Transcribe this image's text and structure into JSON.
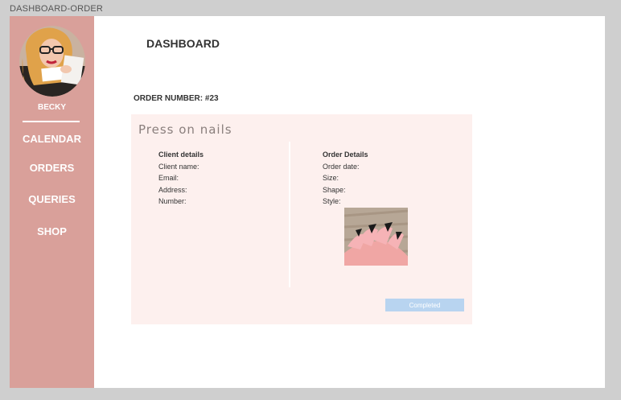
{
  "frame_label": "DASHBOARD-ORDER",
  "sidebar": {
    "user_name": "BECKY",
    "items": [
      {
        "label": "CALENDAR"
      },
      {
        "label": "ORDERS"
      },
      {
        "label": "QUERIES"
      },
      {
        "label": "SHOP"
      }
    ],
    "background": "#d9a09a"
  },
  "header": {
    "title": "DASHBOARD"
  },
  "order": {
    "number_label": "ORDER NUMBER: #23",
    "product_title": "Press on nails",
    "client_details": {
      "heading": "Client details",
      "fields": [
        "Client name:",
        "Email:",
        "Address:",
        "Number:"
      ]
    },
    "order_details": {
      "heading": "Order Details",
      "fields": [
        "Order date:",
        "Size:",
        "Shape:",
        "Style:"
      ]
    },
    "completed_label": "Completed"
  },
  "colors": {
    "card_background": "#fdf0ee",
    "button": "#b8d4f0"
  }
}
